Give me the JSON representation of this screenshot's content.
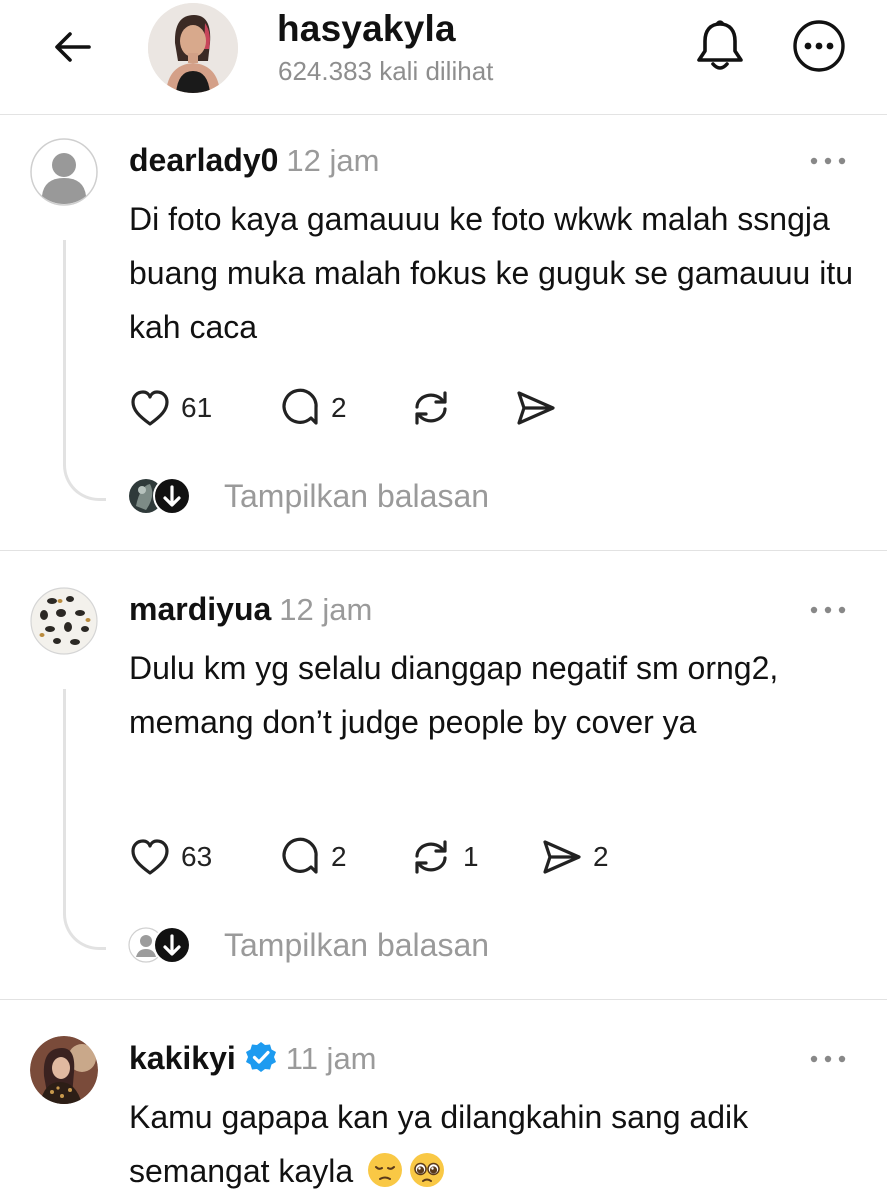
{
  "header": {
    "title": "hasyakyla",
    "subtitle": "624.383 kali dilihat",
    "back_icon": "arrow-left-icon",
    "bell_icon": "bell-icon",
    "more_icon": "more-circle-icon"
  },
  "reply_label": "Tampilkan balasan",
  "colors": {
    "verified": "#1d9bf0",
    "muted": "#9a9a9a",
    "text": "#111111"
  },
  "comments": [
    {
      "username": "dearlady0",
      "time": "12 jam",
      "text": "Di foto kaya gamauuu ke foto wkwk malah ssngja buang muka malah fokus ke guguk se gamauuu itu kah caca",
      "likes": "61",
      "replies": "2",
      "reposts": "",
      "shares": ""
    },
    {
      "username": "mardiyua",
      "time": "12 jam",
      "text": "Dulu km yg selalu dianggap negatif sm orng2, memang don’t judge people by cover ya",
      "likes": "63",
      "replies": "2",
      "reposts": "1",
      "shares": "2"
    },
    {
      "username": "kakikyi",
      "verified": true,
      "time": "11 jam",
      "text": "Kamu gapapa kan ya dilangkahin sang adik semangat kayla",
      "emojis": [
        "pensive-face-emoji",
        "pleading-face-emoji"
      ]
    }
  ]
}
